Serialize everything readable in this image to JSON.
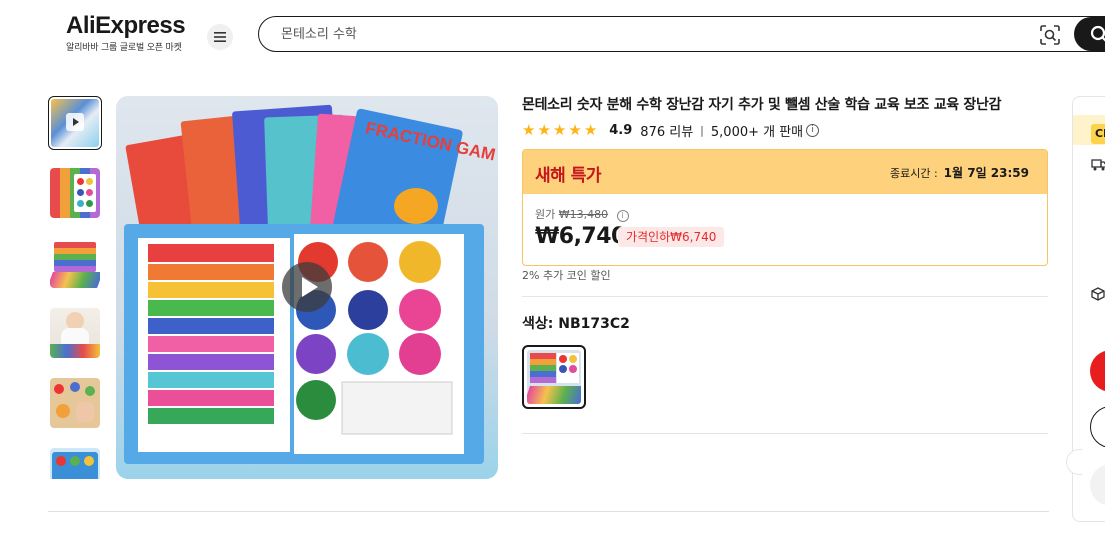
{
  "header": {
    "logo_text": "AliExpress",
    "logo_sub": "알리바바 그룹 글로벌 오픈 마켓",
    "search_placeholder": "몬테소리 수학"
  },
  "product": {
    "title": "몬테소리 숫자 분해 수학 장난감 자기 추가 및 뺄셈 산술 학습 교육 보조 교육 장난감",
    "rating": "4.9",
    "reviews": "876 리뷰",
    "sold": "5,000+ 개 판매",
    "deal": {
      "label": "새해 특가",
      "end_prefix": "종료시간 :",
      "end_time": "1월 7일 23:59",
      "original_prefix": "원가",
      "original_price": "₩13,480",
      "price": "₩6,740",
      "discount": "가격인하₩6,740"
    },
    "coin_discount": "2% 추가 코인 할인",
    "color_label": "색상: NB173C2"
  },
  "right_panel": {
    "badge": "Ch"
  },
  "colors": {
    "deal_bg": "#fed27d",
    "deal_text": "#c4161c",
    "star": "#fdb515",
    "discount_text": "#e52b2b",
    "cta_red": "#e81e1e"
  }
}
